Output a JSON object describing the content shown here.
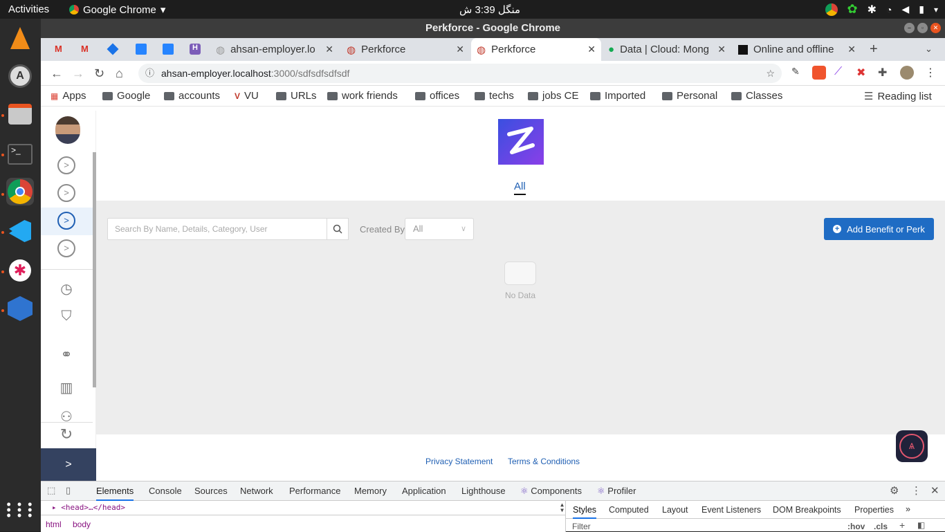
{
  "system": {
    "activities": "Activities",
    "app_name": "Google Chrome",
    "clock": "منگل  3:39 ش"
  },
  "window": {
    "title": "Perkforce - Google Chrome"
  },
  "tabs": [
    {
      "label": "ahsan-employer.lo"
    },
    {
      "label": "Perkforce"
    },
    {
      "label": "Perkforce"
    },
    {
      "label": "Data | Cloud: Mong"
    },
    {
      "label": "Online and offline"
    }
  ],
  "address": {
    "host": "ahsan-employer.localhost",
    "path": ":3000/sdfsdfsdfsdf"
  },
  "bookmarks": [
    "Apps",
    "Google",
    "accounts",
    "VU",
    "URLs",
    "work friends",
    "offices",
    "techs",
    "jobs CE",
    "Imported",
    "Personal",
    "Classes"
  ],
  "reading_list": "Reading list",
  "page": {
    "tab_all": "All",
    "search_placeholder": "Search By Name, Details, Category, User",
    "created_by_label": "Created By",
    "created_by_value": "All",
    "add_button": "Add Benefit or Perk",
    "empty_text": "No Data",
    "footer_privacy": "Privacy Statement",
    "footer_terms": "Terms & Conditions"
  },
  "devtools": {
    "tabs": [
      "Elements",
      "Console",
      "Sources",
      "Network",
      "Performance",
      "Memory",
      "Application",
      "Lighthouse",
      "Components",
      "Profiler"
    ],
    "head_line": "<head>…</head>",
    "crumbs": [
      "html",
      "body"
    ],
    "style_tabs": [
      "Styles",
      "Computed",
      "Layout",
      "Event Listeners",
      "DOM Breakpoints",
      "Properties"
    ],
    "filter": "Filter",
    "hov": ":hov",
    "cls": ".cls"
  },
  "colors": {
    "accent": "#1f6cc4",
    "sidebar_footer": "#344260",
    "ubuntu_orange": "#e95420"
  }
}
